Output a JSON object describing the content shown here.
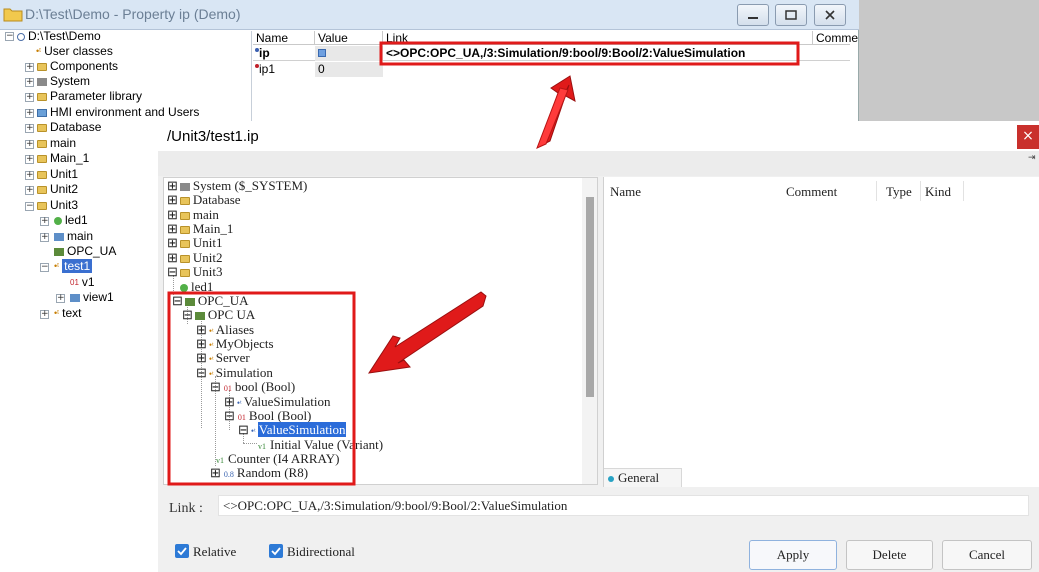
{
  "back_window": {
    "title": "D:\\Test\\Demo - Property ip (Demo)",
    "tree": [
      {
        "label": "D:\\Test\\Demo",
        "icon": "project-icon"
      },
      {
        "label": "User classes",
        "icon": "class-icon"
      },
      {
        "label": "Components",
        "icon": "folder-icon"
      },
      {
        "label": "System",
        "icon": "system-icon"
      },
      {
        "label": "Parameter library",
        "icon": "folder-icon"
      },
      {
        "label": "HMI environment and Users",
        "icon": "hmi-icon"
      },
      {
        "label": "Database",
        "icon": "folder-icon"
      },
      {
        "label": "main",
        "icon": "folder-icon"
      },
      {
        "label": "Main_1",
        "icon": "folder-icon"
      },
      {
        "label": "Unit1",
        "icon": "folder-icon"
      },
      {
        "label": "Unit2",
        "icon": "folder-icon"
      },
      {
        "label": "Unit3",
        "icon": "folder-icon"
      },
      {
        "label": "led1",
        "icon": "led-icon"
      },
      {
        "label": "main",
        "icon": "screen-icon"
      },
      {
        "label": "OPC_UA",
        "icon": "opc-icon"
      },
      {
        "label": "test1",
        "icon": "class-icon"
      },
      {
        "label": "v1",
        "icon": "variable-icon"
      },
      {
        "label": "view1",
        "icon": "screen-icon"
      },
      {
        "label": "text",
        "icon": "class-icon"
      }
    ],
    "columns": [
      "Name",
      "Value",
      "Link",
      "Comme"
    ],
    "rows": [
      {
        "name": "ip",
        "value": "",
        "link": "<>OPC:OPC_UA,/3:Simulation/9:bool/9:Bool/2:ValueSimulation"
      },
      {
        "name": "ip1",
        "value": "0",
        "link": ""
      }
    ]
  },
  "dialog": {
    "title": "/Unit3/test1.ip",
    "close": "×",
    "pin": "⇥",
    "tree": [
      "System ($_SYSTEM)",
      "Database",
      "main",
      "Main_1",
      "Unit1",
      "Unit2",
      "Unit3",
      "led1",
      "OPC_UA",
      "OPC UA",
      "Aliases",
      "MyObjects",
      "Server",
      "Simulation",
      "bool (Bool)",
      "ValueSimulation",
      "Bool (Bool)",
      "ValueSimulation",
      "Initial Value (Variant)",
      "Counter (I4 ARRAY)",
      "Random (R8)"
    ],
    "columns": [
      "Name",
      "Comment",
      "Type",
      "Kind"
    ],
    "tab": "General",
    "link_label": "Link :",
    "link_value": "<>OPC:OPC_UA,/3:Simulation/9:bool/9:Bool/2:ValueSimulation",
    "relative_label": "Relative",
    "bidirectional_label": "Bidirectional",
    "relative_checked": true,
    "bidirectional_checked": true,
    "apply_label": "Apply",
    "delete_label": "Delete",
    "cancel_label": "Cancel"
  },
  "colors": {
    "highlight": "#e01a1a",
    "selection": "#2b6cd9",
    "checkbox": "#2d7ad6"
  }
}
